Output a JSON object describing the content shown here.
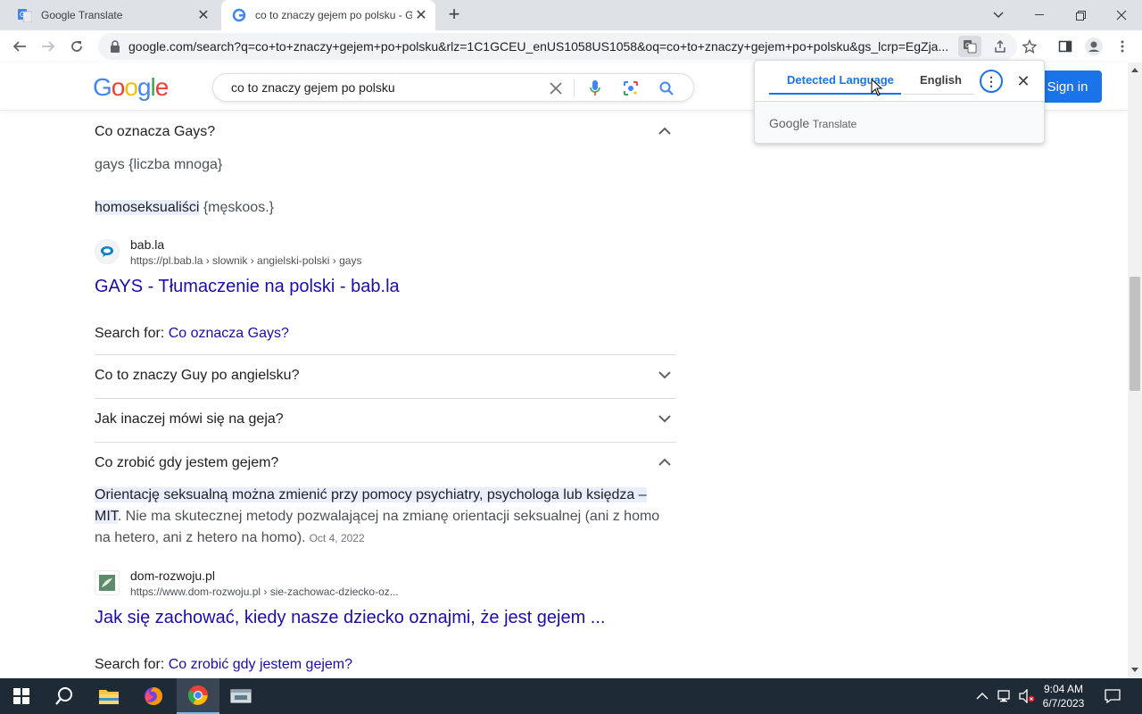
{
  "browser": {
    "tabs": [
      {
        "title": "Google Translate",
        "active": false
      },
      {
        "title": "co to znaczy gejem po polsku - G",
        "active": true
      }
    ],
    "url": "google.com/search?q=co+to+znaczy+gejem+po+polsku&rlz=1C1GCEU_enUS1058US1058&oq=co+to+znaczy+gejem+po+polsku&gs_lcrp=EgZja..."
  },
  "google": {
    "logo": "Google",
    "query": "co to znaczy gejem po polsku",
    "sign_in": "Sign in"
  },
  "translate_popup": {
    "tab_detected": "Detected Language",
    "tab_english": "English",
    "brand_google": "Google",
    "brand_translate": "Translate"
  },
  "results": {
    "q1": {
      "question": "Co oznacza Gays?",
      "expanded": true
    },
    "a1_line1": "gays {liczba mnoga}",
    "a1_word": "homoseksualiści",
    "a1_suffix": " {męskoos.}",
    "src1": {
      "name": "bab.la",
      "url": "https://pl.bab.la › slownik › angielski-polski › gays"
    },
    "link1": "GAYS - Tłumaczenie na polski - bab.la",
    "searchfor1_label": "Search for: ",
    "searchfor1_link": "Co oznacza Gays?",
    "q2": "Co to znaczy Guy po angielsku?",
    "q3": "Jak inaczej mówi się na geja?",
    "q4": "Co zrobić gdy jestem gejem?",
    "a4_highlight": "Orientację seksualną można zmienić przy pomocy psychiatry, psychologa lub księdza – MIT",
    "a4_rest": ". Nie ma skutecznej metody pozwalającej na zmianę orientacji seksualnej (ani z homo na hetero, ani z hetero na homo).",
    "a4_date": "Oct 4, 2022",
    "src2": {
      "name": "dom-rozwoju.pl",
      "url": "https://www.dom-rozwoju.pl › sie-zachowac-dziecko-oz..."
    },
    "link2": "Jak się zachować, kiedy nasze dziecko oznajmi, że jest gejem ...",
    "searchfor2_label": "Search for: ",
    "searchfor2_link": "Co zrobić gdy jestem gejem?"
  },
  "taskbar": {
    "time": "9:04 AM",
    "date": "6/7/2023"
  },
  "colors": {
    "google_blue": "#4285F4",
    "google_red": "#EA4335",
    "google_yellow": "#FBBC05",
    "google_green": "#34A853",
    "link": "#1a0dab",
    "accent": "#1a73e8"
  }
}
